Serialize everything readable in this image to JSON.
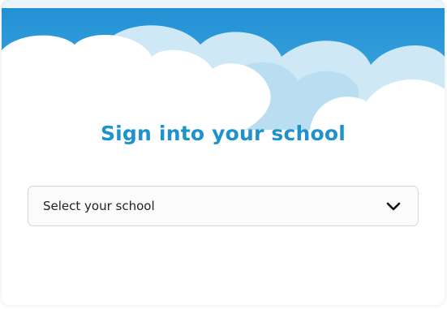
{
  "header": {
    "decoration": "clouds-banner"
  },
  "login": {
    "title": "Sign into your school",
    "school_select": {
      "selected_label": "Select your school",
      "icon": "chevron-down-icon"
    }
  },
  "colors": {
    "title": "#1d92cc",
    "sky": "#2e9ad8",
    "cloud": "#ffffff",
    "cloud_light": "#d6ecf8"
  }
}
